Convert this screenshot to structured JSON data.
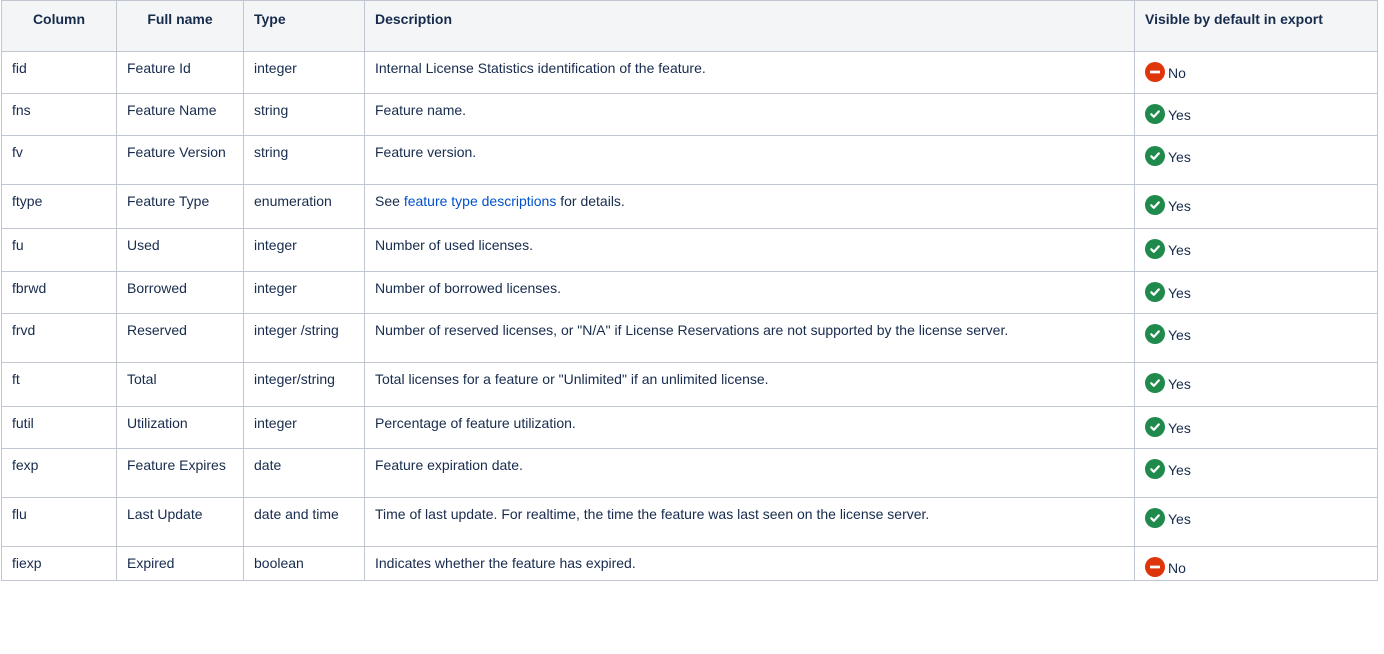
{
  "colors": {
    "yes": "#1f8a4c",
    "no": "#de350b",
    "link": "#0052cc"
  },
  "headers": [
    "Column",
    "Full name",
    "Type",
    "Description",
    "Visible by default in export"
  ],
  "rows": [
    {
      "column": "fid",
      "full_name": "Feature Id",
      "type": "integer",
      "description": "Internal License Statistics identification of the feature.",
      "visible": "No",
      "icon": "minus-circle-icon"
    },
    {
      "column": "fns",
      "full_name": "Feature Name",
      "type": "string",
      "description": "Feature name.",
      "visible": "Yes",
      "icon": "check-circle-icon"
    },
    {
      "column": "fv",
      "full_name": "Feature Version",
      "type": "string",
      "description": "Feature version.",
      "visible": "Yes",
      "icon": "check-circle-icon"
    },
    {
      "column": "ftype",
      "full_name": "Feature Type",
      "type": "enumeration",
      "description_prefix": "See ",
      "description_link": "feature type descriptions",
      "description_suffix": " for details.",
      "visible": "Yes",
      "icon": "check-circle-icon"
    },
    {
      "column": "fu",
      "full_name": "Used",
      "type": "integer",
      "description": "Number of used licenses.",
      "visible": "Yes",
      "icon": "check-circle-icon"
    },
    {
      "column": "fbrwd",
      "full_name": "Borrowed",
      "type": "integer",
      "description": "Number of borrowed licenses.",
      "visible": "Yes",
      "icon": "check-circle-icon"
    },
    {
      "column": "frvd",
      "full_name": "Reserved",
      "type": "integer /string",
      "description": "Number of reserved licenses, or \"N/A\"  if License Reservations are not supported by the license server.",
      "visible": "Yes",
      "icon": "check-circle-icon"
    },
    {
      "column": "ft",
      "full_name": "Total",
      "type": "integer/string",
      "description": "Total licenses for a feature or \"Unlimited\" if an unlimited license.",
      "visible": "Yes",
      "icon": "check-circle-icon"
    },
    {
      "column": "futil",
      "full_name": "Utilization",
      "type": "integer",
      "description": "Percentage of feature utilization.",
      "visible": "Yes",
      "icon": "check-circle-icon"
    },
    {
      "column": "fexp",
      "full_name": "Feature Expires",
      "type": "date",
      "description": "Feature expiration date.",
      "visible": "Yes",
      "icon": "check-circle-icon"
    },
    {
      "column": "flu",
      "full_name": "Last Update",
      "type": "date and time",
      "description": "Time of last update. For realtime, the time the feature was last seen on the license server.",
      "visible": "Yes",
      "icon": "check-circle-icon"
    },
    {
      "column": "fiexp",
      "full_name": "Expired",
      "type": "boolean",
      "description": "Indicates whether the feature has expired.",
      "visible": "No",
      "icon": "minus-circle-icon"
    }
  ]
}
